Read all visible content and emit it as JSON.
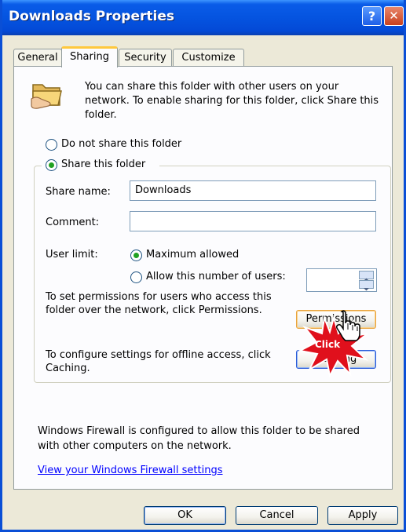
{
  "window": {
    "title": "Downloads Properties",
    "help_label": "?",
    "close_label": "✕"
  },
  "tabs": [
    {
      "label": "General"
    },
    {
      "label": "Sharing"
    },
    {
      "label": "Security"
    },
    {
      "label": "Customize"
    }
  ],
  "sharing": {
    "intro_lines": [
      "You can share this folder with other users on your",
      "network.  To enable sharing for this folder, click Share this",
      "folder."
    ],
    "do_not_share_label": "Do not share this folder",
    "share_label": "Share this folder",
    "share_name_label": "Share name:",
    "share_name_value": "Downloads",
    "comment_label": "Comment:",
    "comment_value": "",
    "user_limit_label": "User limit:",
    "maximum_allowed_label": "Maximum allowed",
    "allow_number_label": "Allow this number of users:",
    "allow_number_value": "",
    "permissions_text_lines": [
      "To set permissions for users who access this",
      "folder over the network, click Permissions."
    ],
    "permissions_button": "Permissions",
    "caching_text_lines": [
      "To configure settings for offline access, click",
      "Caching."
    ],
    "caching_button": "Caching",
    "click_badge": "Click",
    "firewall_lines": [
      "Windows Firewall is configured to allow this folder to be shared",
      "with other computers on the network."
    ],
    "firewall_link": "View your Windows Firewall settings"
  },
  "buttons": {
    "ok": "OK",
    "cancel": "Cancel",
    "apply": "Apply"
  },
  "colors": {
    "titlebar": "#0554E0",
    "selected_radio": "#21A121",
    "tab_highlight": "#FFC83C",
    "click_badge": "#E0101C",
    "link": "#0000FF"
  },
  "icons": {
    "folder": "shared-folder-icon",
    "cursor": "hand-pointer-icon"
  }
}
